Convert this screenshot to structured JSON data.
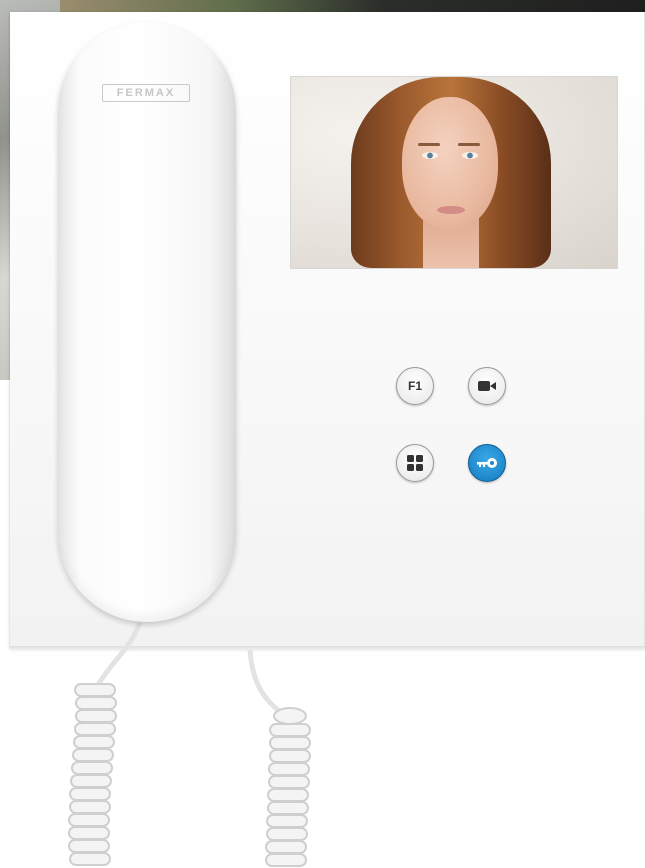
{
  "product": {
    "brand_label": "FERMAX"
  },
  "controls": {
    "f1_label": "F1",
    "camera_button": "camera-icon",
    "menu_button": "grid-menu-icon",
    "door_button": "key-icon"
  },
  "colors": {
    "body": "#ffffff",
    "door_button": "#1f88cc"
  }
}
